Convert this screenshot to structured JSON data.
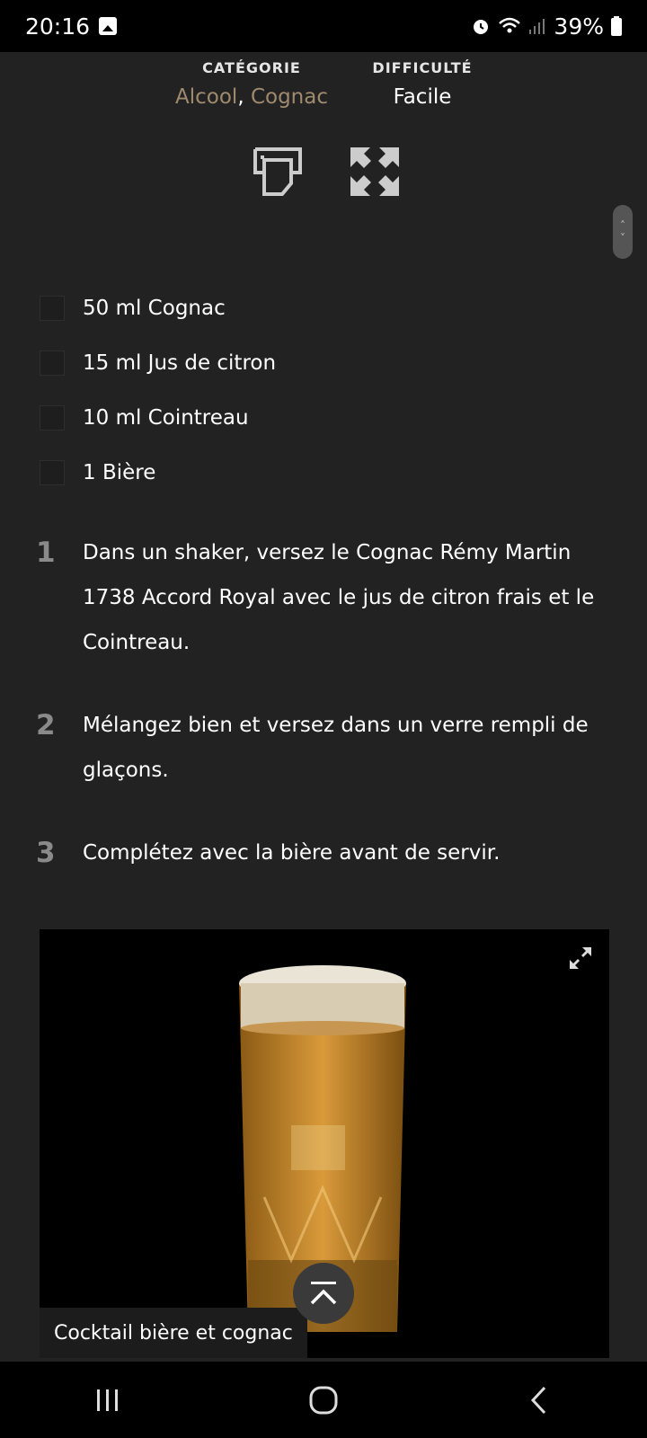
{
  "status_bar": {
    "time": "20:16",
    "battery": "39%",
    "icons": [
      "gallery-icon",
      "alarm-icon",
      "wifi-icon",
      "signal-icon",
      "battery-icon"
    ]
  },
  "meta": {
    "category_label": "CATÉGORIE",
    "category_1": "Alcool",
    "category_sep": ", ",
    "category_2": "Cognac",
    "difficulty_label": "DIFFICULTÉ",
    "difficulty_value": "Facile"
  },
  "actions": {
    "icons": [
      "print-icon",
      "fullscreen-icon"
    ]
  },
  "ingredients": [
    {
      "label": "50 ml Cognac"
    },
    {
      "label": "15 ml Jus de citron"
    },
    {
      "label": "10 ml Cointreau"
    },
    {
      "label": "1 Bière"
    }
  ],
  "steps": [
    {
      "num": "1",
      "text": "Dans un shaker, versez le Cognac Rémy Martin 1738 Accord Royal avec le jus de citron frais et le Cointreau."
    },
    {
      "num": "2",
      "text": "Mélangez bien et versez dans un verre rempli de glaçons."
    },
    {
      "num": "3",
      "text": "Complétez avec la bière avant de servir."
    }
  ],
  "photo": {
    "caption": "Cocktail bière et cognac"
  },
  "colors": {
    "background": "#222222",
    "category_link": "#a08a6e",
    "step_number": "#8a8a8a"
  }
}
